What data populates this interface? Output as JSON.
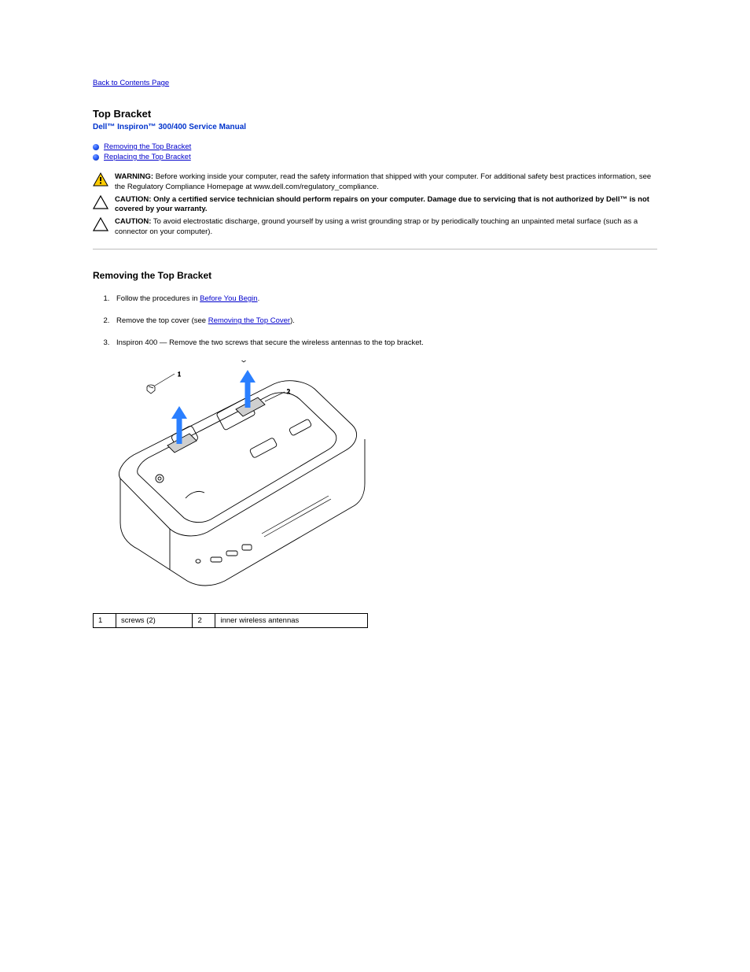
{
  "top": {
    "back": "Back to Contents Page"
  },
  "header": {
    "title": "Top Bracket",
    "subtitle": "Dell™ Inspiron™ 300/400 Service Manual"
  },
  "toc": {
    "item1": "Removing the Top Bracket",
    "item2": "Replacing the Top Bracket"
  },
  "alerts": {
    "warning": {
      "label": "WARNING:",
      "text": " Before working inside your computer, read the safety information that shipped with your computer. For additional safety best practices information, see the Regulatory Compliance Homepage at www.dell.com/regulatory_compliance."
    },
    "caution1": {
      "label": "CAUTION:",
      "text": " Only a certified service technician should perform repairs on your computer. Damage due to servicing that is not authorized by Dell™ is not covered by your warranty."
    },
    "caution2": {
      "label": "CAUTION:",
      "text": " To avoid electrostatic discharge, ground yourself by using a wrist grounding strap or by periodically touching an unpainted metal surface (such as a connector on your computer)."
    }
  },
  "section2": {
    "title": "Removing the Top Bracket"
  },
  "steps": {
    "s1_a": "Follow the procedures in ",
    "s1_link": "Before You Begin",
    "s1_b": ".",
    "s2_a": "Remove the top cover (see ",
    "s2_link": "Removing the Top Cover",
    "s2_b": ").",
    "s3": "Inspiron 400 — Remove the two screws that secure the wireless antennas to the top bracket."
  },
  "table": {
    "c1": "1",
    "c1v": "screws (2)",
    "c2": "2",
    "c2v": "inner wireless antennas"
  }
}
